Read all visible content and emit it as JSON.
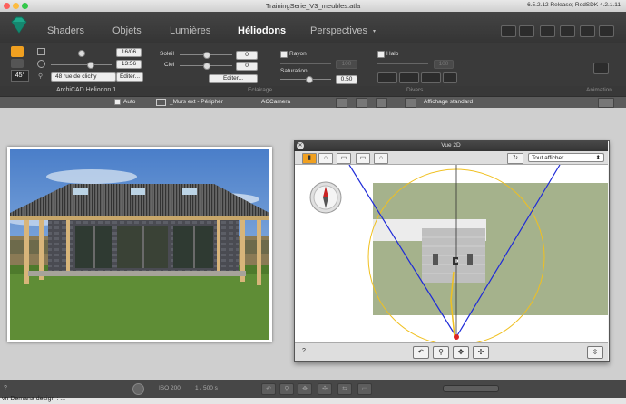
{
  "window": {
    "title": "TrainingSerie_V3_meubles.atla",
    "version": "6.5.2.12 Release; RedSDK 4.2.1.11"
  },
  "nav": {
    "tabs": [
      {
        "label": "Shaders"
      },
      {
        "label": "Objets"
      },
      {
        "label": "Lumières"
      },
      {
        "label": "Héliodons"
      },
      {
        "label": "Perspectives"
      }
    ],
    "active_tab": "Héliodons"
  },
  "heliodon": {
    "angle": "45°",
    "date": "16/06",
    "time": "13:56",
    "location": "48 rue de clichy",
    "edit_label": "Editer...",
    "name": "ArchiCAD Heliodon 1",
    "section_label": "Eclairage"
  },
  "lighting": {
    "soleil_label": "Soleil",
    "soleil_value": "0",
    "ciel_label": "Ciel",
    "ciel_value": "0",
    "edit_label": "Editer...",
    "rayon_label": "Rayon",
    "rayon_value": "100",
    "saturation_label": "Saturation",
    "saturation_value": "0.50"
  },
  "divers": {
    "halo_label": "Halo",
    "halo_value": "100",
    "section_label": "Divers"
  },
  "animation": {
    "section_label": "Animation"
  },
  "toolbar2": {
    "auto_label": "Auto",
    "layer_label": "_Murs ext - Périphér",
    "camera_label": "ACCamera",
    "display_label": "Affichage standard"
  },
  "panel2d": {
    "title": "Vue 2D",
    "filter_label": "Tout afficher",
    "help": "?"
  },
  "bottombar": {
    "iso": "ISO 200",
    "shutter": "1 / 500 s",
    "help": "?"
  },
  "status": {
    "text": "vn Demana design : ..."
  }
}
